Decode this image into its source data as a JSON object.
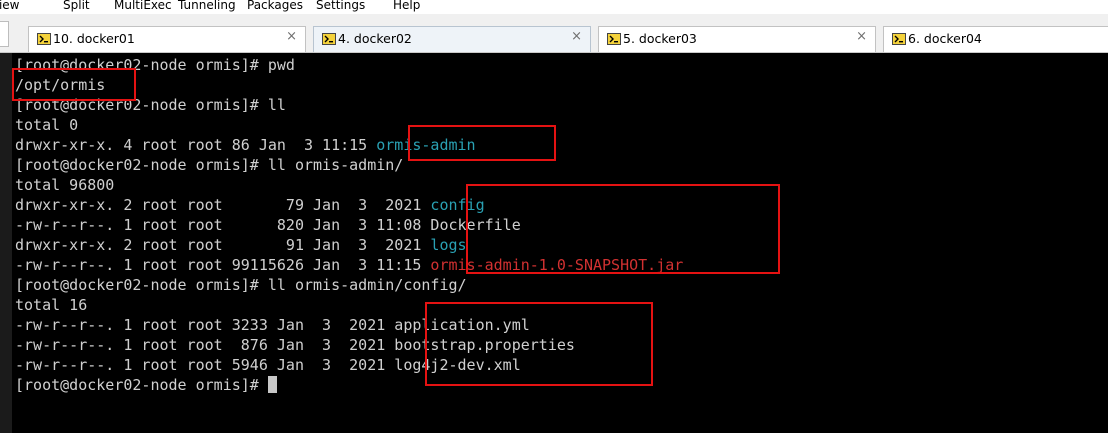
{
  "menu": {
    "items": [
      "View",
      "Split",
      "MultiExec",
      "Tunneling",
      "Packages",
      "Settings",
      "Help"
    ]
  },
  "tabs": [
    {
      "label": "10. docker01",
      "active": false
    },
    {
      "label": "4. docker02",
      "active": true
    },
    {
      "label": "5. docker03",
      "active": false
    },
    {
      "label": "6. docker04",
      "active": false
    }
  ],
  "tab_close_glyph": "×",
  "terminal": {
    "lines": [
      {
        "text": "[root@docker02-node ormis]# pwd"
      },
      {
        "text": "/opt/ormis"
      },
      {
        "text": "[root@docker02-node ormis]# ll"
      },
      {
        "text": "total 0"
      },
      {
        "text": "drwxr-xr-x. 4 root root 86 Jan  3 11:15 ",
        "name": "ormis-admin",
        "kind": "dir"
      },
      {
        "text": "[root@docker02-node ormis]# ll ormis-admin/"
      },
      {
        "text": "total 96800"
      },
      {
        "text": "drwxr-xr-x. 2 root root       79 Jan  3  2021 ",
        "name": "config",
        "kind": "dir"
      },
      {
        "text": "-rw-r--r--. 1 root root      820 Jan  3 11:08 ",
        "name": "Dockerfile",
        "kind": "file"
      },
      {
        "text": "drwxr-xr-x. 2 root root       91 Jan  3  2021 ",
        "name": "logs",
        "kind": "dir"
      },
      {
        "text": "-rw-r--r--. 1 root root 99115626 Jan  3 11:15 ",
        "name": "ormis-admin-1.0-SNAPSHOT.jar",
        "kind": "jar"
      },
      {
        "text": "[root@docker02-node ormis]# ll ormis-admin/config/"
      },
      {
        "text": "total 16"
      },
      {
        "text": "-rw-r--r--. 1 root root 3233 Jan  3  2021 ",
        "name": "application.yml",
        "kind": "file"
      },
      {
        "text": "-rw-r--r--. 1 root root  876 Jan  3  2021 ",
        "name": "bootstrap.properties",
        "kind": "file"
      },
      {
        "text": "-rw-r--r--. 1 root root 5946 Jan  3  2021 ",
        "name": "log4j2-dev.xml",
        "kind": "file"
      },
      {
        "text": "[root@docker02-node ormis]# "
      }
    ]
  },
  "colors": {
    "terminal_bg": "#000000",
    "terminal_fg": "#d0d0d0",
    "directory": "#2aa1b3",
    "archive": "#d23131",
    "highlight_box": "#e51212"
  }
}
